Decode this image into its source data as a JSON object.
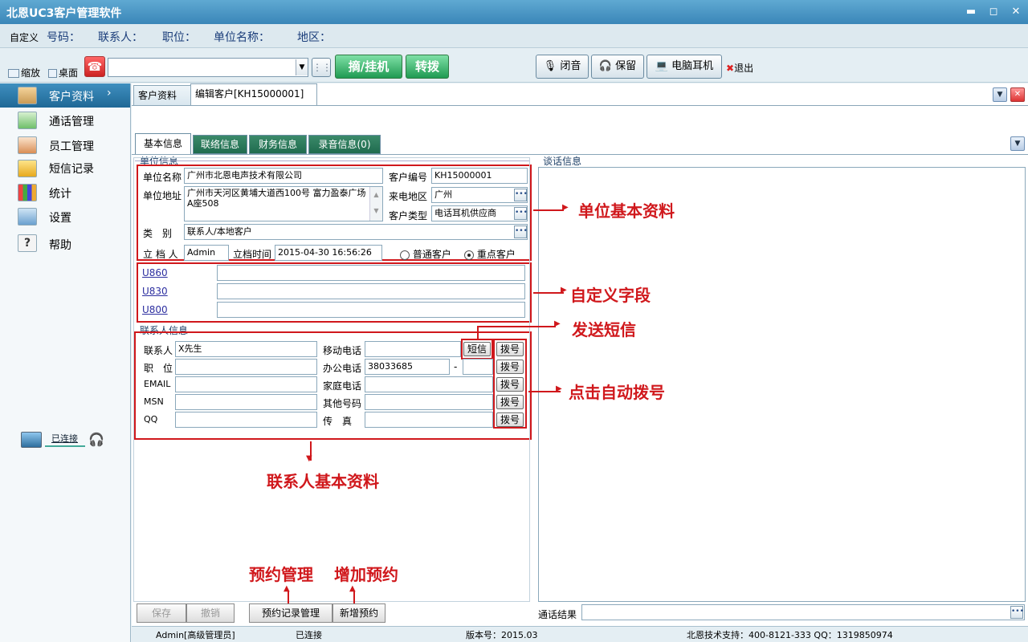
{
  "window": {
    "title": "北恩UC3客户管理软件"
  },
  "infobar": {
    "custom": "自定义",
    "number": "号码：",
    "contact": "联系人：",
    "position": "职位：",
    "company": "单位名称：",
    "region": "地区："
  },
  "toolbar": {
    "shrink": "缩放",
    "desktop": "桌面",
    "pickup": "摘/挂机",
    "transfer": "转拨",
    "mute": "闭音",
    "hold": "保留",
    "headset": "电脑耳机",
    "exit": "退出"
  },
  "sidebar": {
    "items": [
      {
        "label": "客户资料",
        "icon": "customer-icon",
        "arrow": "›"
      },
      {
        "label": "通话管理",
        "icon": "call-icon"
      },
      {
        "label": "员工管理",
        "icon": "staff-icon"
      },
      {
        "label": "短信记录",
        "icon": "sms-icon"
      },
      {
        "label": "统计",
        "icon": "chart-icon"
      },
      {
        "label": "设置",
        "icon": "settings-icon"
      },
      {
        "label": "帮助",
        "icon": "help-icon"
      }
    ],
    "status": "已连接"
  },
  "tabs": [
    {
      "label": "客户资料"
    },
    {
      "label": "编辑客户[KH15000001]"
    }
  ],
  "subtabs": [
    {
      "label": "基本信息"
    },
    {
      "label": "联络信息"
    },
    {
      "label": "财务信息"
    },
    {
      "label": "录音信息(0)"
    }
  ],
  "company": {
    "section": "单位信息",
    "name_label": "单位名称",
    "name": "广州市北恩电声技术有限公司",
    "code_label": "客户编号",
    "code": "KH15000001",
    "address_label": "单位地址",
    "address": "广州市天河区黄埔大道西100号 富力盈泰广场A座508",
    "region_label": "来电地区",
    "region": "广州",
    "type_label": "客户类型",
    "type": "电话耳机供应商",
    "category_label": "类　别",
    "category": "联系人/本地客户",
    "creator_label": "立 档 人",
    "creator": "Admin",
    "time_label": "立档时间",
    "time": "2015-04-30 16:56:26",
    "radio_normal": "普通客户",
    "radio_key": "重点客户"
  },
  "custom_fields": [
    {
      "label": "U860",
      "value": ""
    },
    {
      "label": "U830",
      "value": ""
    },
    {
      "label": "U800",
      "value": ""
    }
  ],
  "contact": {
    "section": "联系人信息",
    "person_label": "联系人",
    "person": "X先生",
    "mobile_label": "移动电话",
    "mobile": "",
    "position_label": "职　位",
    "position": "",
    "office_label": "办公电话",
    "office": "38033685",
    "dash": "-",
    "email_label": "EMAIL",
    "email": "",
    "home_label": "家庭电话",
    "home": "",
    "msn_label": "MSN",
    "msn": "",
    "other_label": "其他号码",
    "other": "",
    "qq_label": "QQ",
    "qq": "",
    "fax_label": "传　真",
    "fax": "",
    "sms_button": "短信",
    "dial_button": "拨号"
  },
  "talk": {
    "section": "谈话信息",
    "result_label": "通话结果"
  },
  "buttons": {
    "save": "保存",
    "undo": "撤销",
    "appt_manage": "预约记录管理",
    "appt_add": "新增预约"
  },
  "annotations": {
    "company": "单位基本资料",
    "custom": "自定义字段",
    "sms": "发送短信",
    "dial": "点击自动拨号",
    "contact": "联系人基本资料",
    "appt_manage": "预约管理",
    "appt_add": "增加预约"
  },
  "status": {
    "user": "Admin[高级管理员]",
    "conn": "已连接",
    "version": "版本号：2015.03",
    "support": "北恩技术支持：400-8121-333 QQ：1319850974"
  },
  "colors": {
    "annotation": "#d0181c",
    "titlebar": "#3a86b8",
    "active_nav": "#1f6896"
  }
}
